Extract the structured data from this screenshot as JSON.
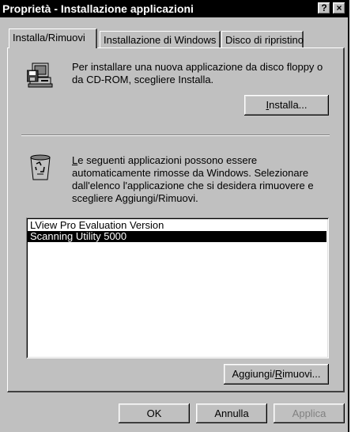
{
  "window": {
    "title": "Proprietà - Installazione applicazioni",
    "help_label": "?",
    "close_label": "×"
  },
  "tabs": [
    {
      "label": "Installa/Rimuovi"
    },
    {
      "label": "Installazione di Windows"
    },
    {
      "label": "Disco di ripristino"
    }
  ],
  "install": {
    "description": "Per installare una nuova applicazione da disco floppy o da CD-ROM, scegliere Installa.",
    "button_prefix": "",
    "button_mnemonic": "I",
    "button_rest": "nstalla..."
  },
  "remove": {
    "description_mnemonic": "L",
    "description_rest": "e seguenti applicazioni possono essere automaticamente rimosse da Windows. Selezionare dall'elenco l'applicazione che si desidera rimuovere e scegliere Aggiungi/Rimuovi.",
    "items": [
      {
        "label": "LView Pro Evaluation Version"
      },
      {
        "label": "Scanning Utility 5000"
      }
    ],
    "button_prefix": "Aggiungi/",
    "button_mnemonic": "R",
    "button_rest": "imuovi..."
  },
  "footer": {
    "ok_label": "OK",
    "cancel_label": "Annulla",
    "apply_label": "Applica"
  }
}
